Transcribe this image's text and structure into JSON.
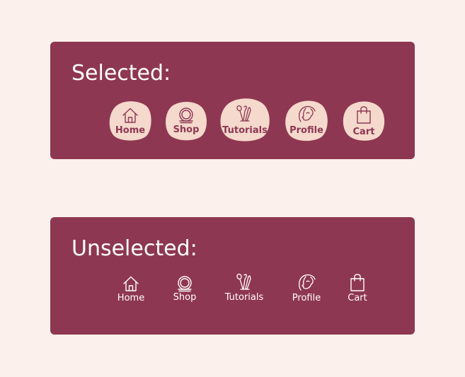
{
  "selected_section": {
    "title": "Selected:",
    "items": [
      {
        "label": "Home",
        "icon": "home-icon"
      },
      {
        "label": "Shop",
        "icon": "mirror-icon"
      },
      {
        "label": "Tutorials",
        "icon": "makeup-brushes-icon"
      },
      {
        "label": "Profile",
        "icon": "face-profile-icon"
      },
      {
        "label": "Cart",
        "icon": "shopping-bag-icon"
      }
    ]
  },
  "unselected_section": {
    "title": "Unselected:",
    "items": [
      {
        "label": "Home",
        "icon": "home-icon"
      },
      {
        "label": "Shop",
        "icon": "mirror-icon"
      },
      {
        "label": "Tutorials",
        "icon": "makeup-brushes-icon"
      },
      {
        "label": "Profile",
        "icon": "face-profile-icon"
      },
      {
        "label": "Cart",
        "icon": "shopping-bag-icon"
      }
    ]
  },
  "colors": {
    "page_background": "#FBF0EC",
    "panel_background": "#8E3752",
    "selected_blob": "#F4D9CC",
    "selected_text": "#8E3752",
    "unselected_text": "#FFFFFF"
  }
}
